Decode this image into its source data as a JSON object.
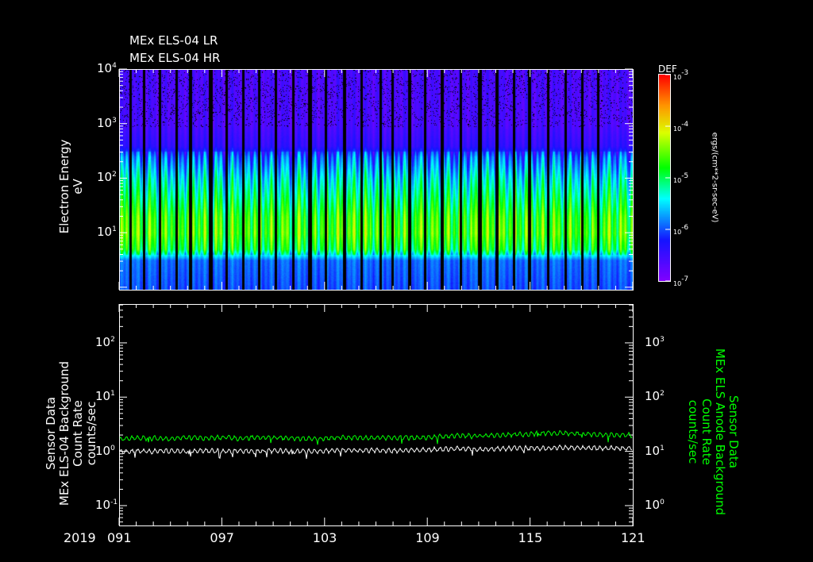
{
  "titles": [
    "MEx ELS-04 LR",
    "MEx ELS-04 HR"
  ],
  "x_axis": {
    "year": "2019",
    "tick_labels": [
      "091",
      "097",
      "103",
      "109",
      "115",
      "121"
    ],
    "tick_days": [
      91,
      97,
      103,
      109,
      115,
      121
    ],
    "range": [
      91,
      121
    ]
  },
  "colors": {
    "background": "#000000",
    "axis": "#ffffff",
    "line_left": "#ffffff",
    "line_right": "#00ff00"
  },
  "chart_data": [
    {
      "type": "heatmap",
      "title": "MEx ELS-04 LR / MEx ELS-04 HR",
      "ylabel": "Electron Energy",
      "yunit": "eV",
      "yscale": "log",
      "ylim": [
        0.9,
        10000
      ],
      "ytick_exponents": [
        1,
        2,
        3,
        4
      ],
      "xlim": [
        91,
        121
      ],
      "colorbar": {
        "label": "DEF",
        "unit": "ergs/(cm**2-sr-sec-eV)",
        "range_log10": [
          -7,
          -3
        ],
        "tick_exponents": [
          -3,
          -4,
          -5,
          -6,
          -7
        ],
        "colormap": "rainbow"
      },
      "profile_log10_def": {
        "energy_log10": [
          0,
          0.5,
          0.7,
          1.0,
          1.3,
          1.6,
          2.0,
          2.4,
          2.6,
          3.0,
          4.0
        ],
        "def": [
          -6.0,
          -5.9,
          -4.9,
          -4.6,
          -4.7,
          -5.0,
          -5.4,
          -5.9,
          -6.4,
          -6.6,
          -6.6
        ]
      },
      "data_gap_days": [
        91.6,
        92.4,
        93.3,
        94.3,
        95.1,
        96.3,
        97.2,
        98.2,
        99.1,
        100.1,
        101.1,
        102.1,
        103.0,
        104.1,
        105.1,
        106.2,
        106.9,
        107.9,
        108.8,
        109.8,
        110.9,
        112.0,
        113.0,
        114.0,
        114.9,
        116.0,
        117.0,
        118.0,
        118.9
      ],
      "black_gap_days": [
        102.1,
        112.0,
        96.3
      ]
    },
    {
      "type": "line",
      "x": [
        91,
        92,
        93,
        94,
        95,
        96,
        97,
        98,
        99,
        100,
        101,
        102,
        103,
        104,
        105,
        106,
        107,
        108,
        109,
        110,
        111,
        112,
        113,
        114,
        115,
        116,
        117,
        118,
        119,
        120,
        121
      ],
      "series": [
        {
          "name": "MEx ELS-04 Background Count Rate",
          "axis": "left",
          "values": [
            1.0,
            1.0,
            1.0,
            1.02,
            1.0,
            1.03,
            1.0,
            1.02,
            1.0,
            1.03,
            1.0,
            1.0,
            1.02,
            1.05,
            1.03,
            1.05,
            1.03,
            1.05,
            1.07,
            1.1,
            1.12,
            1.1,
            1.12,
            1.15,
            1.15,
            1.15,
            1.18,
            1.15,
            1.15,
            1.15,
            1.15
          ]
        },
        {
          "name": "MEx ELS Anode Background Count Rate",
          "axis": "right",
          "values": [
            17,
            17.5,
            17.5,
            17,
            18,
            17.5,
            18,
            17.5,
            18,
            18,
            17.5,
            17,
            17.5,
            18,
            18,
            17.5,
            18,
            18,
            18,
            19,
            19.5,
            19,
            20,
            20.5,
            21,
            22,
            21.5,
            21,
            20.5,
            20,
            20
          ]
        }
      ],
      "left_axis": {
        "label_lines": [
          "Sensor Data",
          "MEx ELS-04 Background",
          "Count Rate",
          "counts/sec"
        ],
        "ylim": [
          0.043,
          520
        ],
        "tick_exponents": [
          -1,
          0,
          1,
          2
        ]
      },
      "right_axis": {
        "label_lines": [
          "Sensor Data",
          "MEx ELS Anode Background",
          "Count Rate",
          "counts/sec"
        ],
        "ylim": [
          0.43,
          5200
        ],
        "tick_exponents": [
          0,
          1,
          2,
          3
        ]
      }
    }
  ]
}
